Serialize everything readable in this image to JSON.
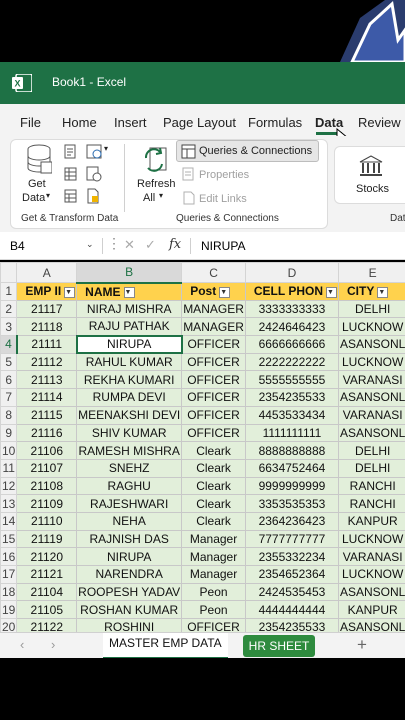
{
  "app": {
    "title": "Book1  -  Excel"
  },
  "menu": [
    "File",
    "Home",
    "Insert",
    "Page Layout",
    "Formulas",
    "Data",
    "Review"
  ],
  "ribbon": {
    "get_data_line1": "Get",
    "get_data_line2": "Data",
    "get_transform_label": "Get & Transform Data",
    "refresh_line1": "Refresh",
    "refresh_line2": "All",
    "queries_connections": "Queries & Connections",
    "properties": "Properties",
    "edit_links": "Edit Links",
    "queries_group_label": "Queries & Connections",
    "stocks": "Stocks",
    "data_types_label": "Dat"
  },
  "formula_bar": {
    "name_box": "B4",
    "fx": "fx",
    "value": "NIRUPA"
  },
  "columns": [
    "A",
    "B",
    "C",
    "D",
    "E"
  ],
  "headers": [
    "EMP II",
    "NAME",
    "Post",
    "CELL PHON",
    "CITY"
  ],
  "rows": [
    [
      "21117",
      "NIRAJ MISHRA",
      "MANAGER",
      "3333333333",
      "DELHI"
    ],
    [
      "21118",
      "RAJU PATHAK",
      "MANAGER",
      "2424646423",
      "LUCKNOW"
    ],
    [
      "21111",
      "NIRUPA",
      "OFFICER",
      "6666666666",
      "ASANSONL"
    ],
    [
      "21112",
      "RAHUL KUMAR",
      "OFFICER",
      "2222222222",
      "LUCKNOW"
    ],
    [
      "21113",
      "REKHA KUMARI",
      "OFFICER",
      "5555555555",
      "VARANASI"
    ],
    [
      "21114",
      "RUMPA DEVI",
      "OFFICER",
      "2354235533",
      "ASANSONL"
    ],
    [
      "21115",
      "MEENAKSHI DEVI",
      "OFFICER",
      "4453533434",
      "VARANASI"
    ],
    [
      "21116",
      "SHIV KUMAR",
      "OFFICER",
      "1111111111",
      "ASANSONL"
    ],
    [
      "21106",
      "RAMESH MISHRA",
      "Cleark",
      "8888888888",
      "DELHI"
    ],
    [
      "21107",
      "SNEHZ",
      "Cleark",
      "6634752464",
      "DELHI"
    ],
    [
      "21108",
      "RAGHU",
      "Cleark",
      "9999999999",
      "RANCHI"
    ],
    [
      "21109",
      "RAJESHWARI",
      "Cleark",
      "3353535353",
      "RANCHI"
    ],
    [
      "21110",
      "NEHA",
      "Cleark",
      "2364236423",
      "KANPUR"
    ],
    [
      "21119",
      "RAJNISH DAS",
      "Manager",
      "7777777777",
      "LUCKNOW"
    ],
    [
      "21120",
      "NIRUPA",
      "Manager",
      "2355332234",
      "VARANASI"
    ],
    [
      "21121",
      "NARENDRA",
      "Manager",
      "2354652364",
      "LUCKNOW"
    ],
    [
      "21104",
      "ROOPESH YADAV",
      "Peon",
      "2424535453",
      "ASANSONL"
    ],
    [
      "21105",
      "ROSHAN KUMAR",
      "Peon",
      "4444444444",
      "KANPUR"
    ],
    [
      "21122",
      "ROSHINI",
      "OFFICER",
      "2354235533",
      "ASANSONL"
    ]
  ],
  "sheets": {
    "tab1": "MASTER EMP DATA",
    "tab2": "HR SHEET",
    "add": "+"
  },
  "colors": {
    "excel_green": "#1e7145",
    "header_fill": "#ffd24d",
    "data_fill": "#e2efda"
  }
}
